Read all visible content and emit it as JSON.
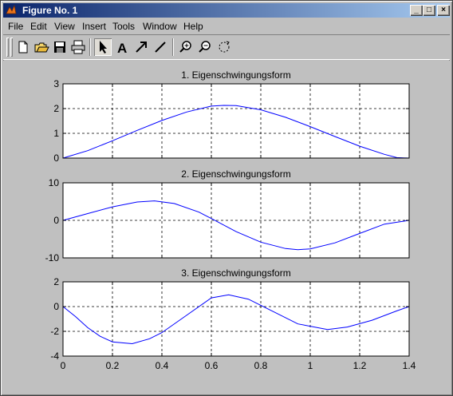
{
  "window": {
    "title": "Figure No. 1",
    "buttons": {
      "minimize": "_",
      "maximize": "□",
      "close": "×"
    }
  },
  "menu": [
    {
      "label": "File"
    },
    {
      "label": "Edit"
    },
    {
      "label": "View"
    },
    {
      "label": "Insert"
    },
    {
      "label": "Tools"
    },
    {
      "label": "Window"
    },
    {
      "label": "Help"
    }
  ],
  "toolbar": {
    "icons": [
      "new-file-icon",
      "open-folder-icon",
      "save-icon",
      "print-icon",
      "pointer-arrow-icon",
      "text-insert-icon",
      "arrow-insert-icon",
      "line-insert-icon",
      "zoom-in-icon",
      "zoom-out-icon",
      "rotate-icon"
    ],
    "text_tool": "A"
  },
  "chart_data": [
    {
      "type": "line",
      "title": "1. Eigenschwingungsform",
      "xlim": [
        0,
        1.4
      ],
      "ylim": [
        0,
        3
      ],
      "yticks": [
        0,
        1,
        2,
        3
      ],
      "grid": true,
      "color": "#0000ff",
      "x": [
        0,
        0.1,
        0.2,
        0.3,
        0.4,
        0.5,
        0.6,
        0.65,
        0.7,
        0.8,
        0.9,
        1.0,
        1.1,
        1.2,
        1.3,
        1.35,
        1.4
      ],
      "y": [
        0,
        0.3,
        0.7,
        1.12,
        1.52,
        1.86,
        2.1,
        2.13,
        2.12,
        1.95,
        1.65,
        1.27,
        0.87,
        0.48,
        0.15,
        0.02,
        0
      ]
    },
    {
      "type": "line",
      "title": "2. Eigenschwingungsform",
      "xlim": [
        0,
        1.4
      ],
      "ylim": [
        -10,
        10
      ],
      "yticks": [
        -10,
        0,
        10
      ],
      "grid": true,
      "color": "#0000ff",
      "x": [
        0,
        0.1,
        0.2,
        0.3,
        0.37,
        0.45,
        0.55,
        0.6,
        0.7,
        0.8,
        0.9,
        0.95,
        1.0,
        1.1,
        1.2,
        1.3,
        1.4
      ],
      "y": [
        0,
        1.8,
        3.6,
        4.9,
        5.2,
        4.5,
        2.2,
        0.5,
        -3.0,
        -5.8,
        -7.5,
        -7.8,
        -7.6,
        -6.0,
        -3.5,
        -1.0,
        0
      ]
    },
    {
      "type": "line",
      "title": "3. Eigenschwingungsform",
      "xlim": [
        0,
        1.4
      ],
      "ylim": [
        -4,
        2
      ],
      "yticks": [
        -4,
        -2,
        0,
        2
      ],
      "xticks": [
        0,
        0.2,
        0.4,
        0.6,
        0.8,
        1,
        1.2,
        1.4
      ],
      "grid": true,
      "color": "#0000ff",
      "x": [
        0,
        0.05,
        0.1,
        0.15,
        0.2,
        0.28,
        0.35,
        0.4,
        0.5,
        0.6,
        0.67,
        0.75,
        0.85,
        0.95,
        1.07,
        1.15,
        1.25,
        1.35,
        1.4
      ],
      "y": [
        0,
        -0.8,
        -1.7,
        -2.4,
        -2.85,
        -3.0,
        -2.6,
        -2.1,
        -0.7,
        0.7,
        0.95,
        0.6,
        -0.4,
        -1.4,
        -1.85,
        -1.65,
        -1.1,
        -0.35,
        0
      ]
    }
  ]
}
